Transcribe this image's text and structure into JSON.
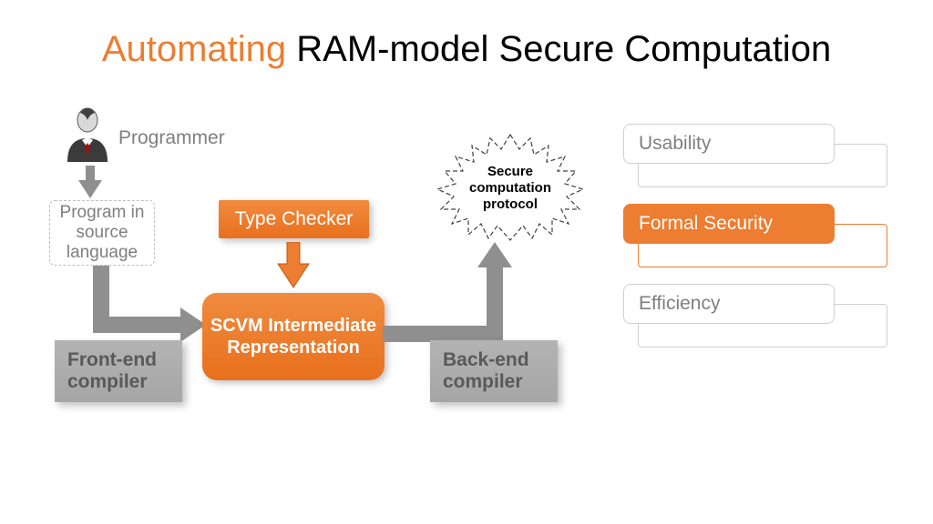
{
  "title": {
    "accent": "Automating",
    "rest": " RAM-model Secure Computation"
  },
  "programmer_label": "Programmer",
  "source_box": "Program in source language",
  "type_checker": "Type Checker",
  "scvm": "SCVM Intermediate Representation",
  "frontend": "Front-end compiler",
  "backend": "Back-end compiler",
  "starburst": "Secure computation protocol",
  "properties": {
    "p1": "Usability",
    "p2": "Formal Security",
    "p3": "Efficiency"
  },
  "colors": {
    "accent": "#ed7d31",
    "gray_text": "#7f7f7f",
    "arrow_gray": "#8f8f8f",
    "arrow_orange": "#ed7d31"
  }
}
